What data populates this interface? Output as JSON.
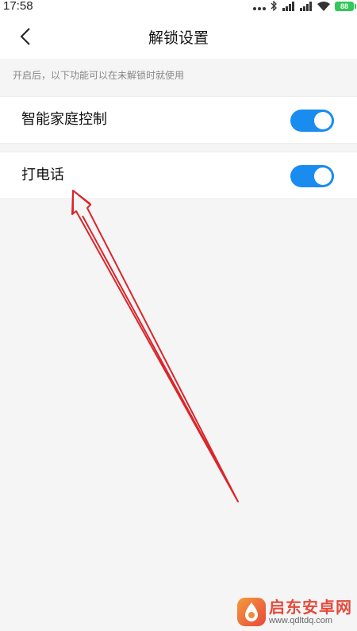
{
  "status_bar": {
    "time": "17:58",
    "battery": "88"
  },
  "header": {
    "title": "解锁设置"
  },
  "hint": "开启后，以下功能可以在未解锁时就使用",
  "settings": [
    {
      "label": "智能家庭控制",
      "enabled": true
    },
    {
      "label": "打电话",
      "enabled": true
    }
  ],
  "watermark": {
    "name": "启东安卓网",
    "url": "www.qdltdq.com"
  },
  "colors": {
    "toggle_on": "#1a8cf0",
    "annotation_arrow": "#d9262c",
    "background": "#f5f5f5"
  }
}
